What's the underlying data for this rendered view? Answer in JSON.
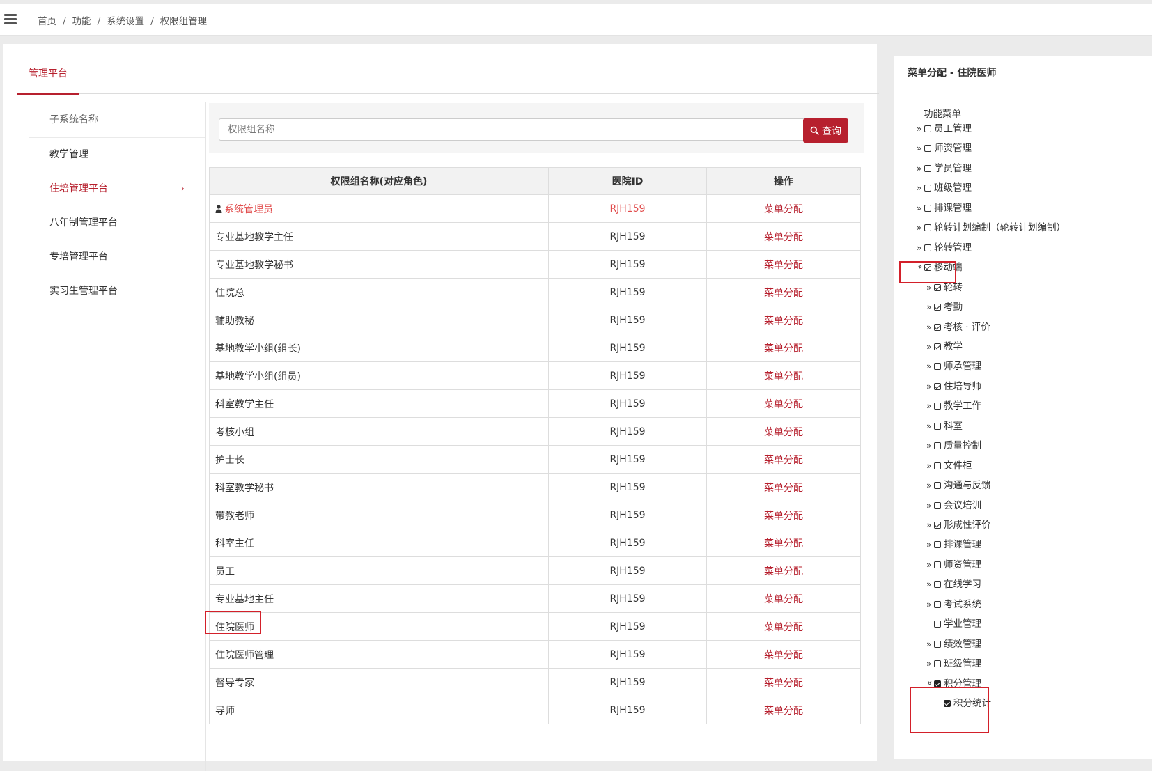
{
  "breadcrumb": [
    "首页",
    "功能",
    "系统设置",
    "权限组管理"
  ],
  "tab": {
    "label": "管理平台"
  },
  "subsystems": {
    "header": "子系统名称",
    "items": [
      "教学管理",
      "住培管理平台",
      "八年制管理平台",
      "专培管理平台",
      "实习生管理平台"
    ],
    "active_index": 1
  },
  "search": {
    "placeholder": "权限组名称",
    "button_label": "查询"
  },
  "table": {
    "headers": [
      "权限组名称(对应角色)",
      "医院ID",
      "操作"
    ],
    "action_label": "菜单分配",
    "rows": [
      {
        "name": "系统管理员",
        "id": "RJH159"
      },
      {
        "name": "专业基地教学主任",
        "id": "RJH159"
      },
      {
        "name": "专业基地教学秘书",
        "id": "RJH159"
      },
      {
        "name": "住院总",
        "id": "RJH159"
      },
      {
        "name": "辅助教秘",
        "id": "RJH159"
      },
      {
        "name": "基地教学小组(组长)",
        "id": "RJH159"
      },
      {
        "name": "基地教学小组(组员)",
        "id": "RJH159"
      },
      {
        "name": "科室教学主任",
        "id": "RJH159"
      },
      {
        "name": "考核小组",
        "id": "RJH159"
      },
      {
        "name": "护士长",
        "id": "RJH159"
      },
      {
        "name": "科室教学秘书",
        "id": "RJH159"
      },
      {
        "name": "带教老师",
        "id": "RJH159"
      },
      {
        "name": "科室主任",
        "id": "RJH159"
      },
      {
        "name": "员工",
        "id": "RJH159"
      },
      {
        "name": "专业基地主任",
        "id": "RJH159"
      },
      {
        "name": "住院医师",
        "id": "RJH159"
      },
      {
        "name": "住院医师管理",
        "id": "RJH159"
      },
      {
        "name": "督导专家",
        "id": "RJH159"
      },
      {
        "name": "导师",
        "id": "RJH159"
      }
    ]
  },
  "menu_panel": {
    "title": "菜单分配 - 住院医师",
    "root_label": "功能菜单",
    "nodes": [
      {
        "label": "员工管理",
        "level": 0,
        "checked": false,
        "expander": "collapsed"
      },
      {
        "label": "师资管理",
        "level": 0,
        "checked": false,
        "expander": "collapsed"
      },
      {
        "label": "学员管理",
        "level": 0,
        "checked": false,
        "expander": "collapsed"
      },
      {
        "label": "班级管理",
        "level": 0,
        "checked": false,
        "expander": "collapsed"
      },
      {
        "label": "排课管理",
        "level": 0,
        "checked": false,
        "expander": "collapsed"
      },
      {
        "label": "轮转计划编制（轮转计划编制）",
        "level": 0,
        "checked": false,
        "expander": "collapsed"
      },
      {
        "label": "轮转管理",
        "level": 0,
        "checked": false,
        "expander": "collapsed"
      },
      {
        "label": "移动端",
        "level": 0,
        "checked": true,
        "expander": "expanded"
      },
      {
        "label": "轮转",
        "level": 1,
        "checked": true,
        "expander": "collapsed"
      },
      {
        "label": "考勤",
        "level": 1,
        "checked": true,
        "expander": "collapsed"
      },
      {
        "label": "考核 · 评价",
        "level": 1,
        "checked": true,
        "expander": "collapsed"
      },
      {
        "label": "教学",
        "level": 1,
        "checked": true,
        "expander": "collapsed"
      },
      {
        "label": "师承管理",
        "level": 1,
        "checked": false,
        "expander": "collapsed"
      },
      {
        "label": "住培导师",
        "level": 1,
        "checked": true,
        "expander": "collapsed"
      },
      {
        "label": "教学工作",
        "level": 1,
        "checked": false,
        "expander": "collapsed"
      },
      {
        "label": "科室",
        "level": 1,
        "checked": false,
        "expander": "collapsed"
      },
      {
        "label": "质量控制",
        "level": 1,
        "checked": false,
        "expander": "collapsed"
      },
      {
        "label": "文件柜",
        "level": 1,
        "checked": false,
        "expander": "collapsed"
      },
      {
        "label": "沟通与反馈",
        "level": 1,
        "checked": false,
        "expander": "collapsed"
      },
      {
        "label": "会议培训",
        "level": 1,
        "checked": false,
        "expander": "collapsed"
      },
      {
        "label": "形成性评价",
        "level": 1,
        "checked": true,
        "expander": "collapsed"
      },
      {
        "label": "排课管理",
        "level": 1,
        "checked": false,
        "expander": "collapsed"
      },
      {
        "label": "师资管理",
        "level": 1,
        "checked": false,
        "expander": "collapsed"
      },
      {
        "label": "在线学习",
        "level": 1,
        "checked": false,
        "expander": "collapsed"
      },
      {
        "label": "考试系统",
        "level": 1,
        "checked": false,
        "expander": "collapsed"
      },
      {
        "label": "学业管理",
        "level": 1,
        "checked": false,
        "expander": "none"
      },
      {
        "label": "绩效管理",
        "level": 1,
        "checked": false,
        "expander": "collapsed"
      },
      {
        "label": "班级管理",
        "level": 1,
        "checked": false,
        "expander": "collapsed"
      },
      {
        "label": "积分管理",
        "level": 1,
        "checked": true,
        "expander": "expanded",
        "style": "dark"
      },
      {
        "label": "积分统计",
        "level": 2,
        "checked": true,
        "expander": "none",
        "style": "dark"
      }
    ]
  },
  "colors": {
    "accent": "#b7202e",
    "highlight_box": "#d3202a",
    "admin_text": "#e14d4d"
  }
}
